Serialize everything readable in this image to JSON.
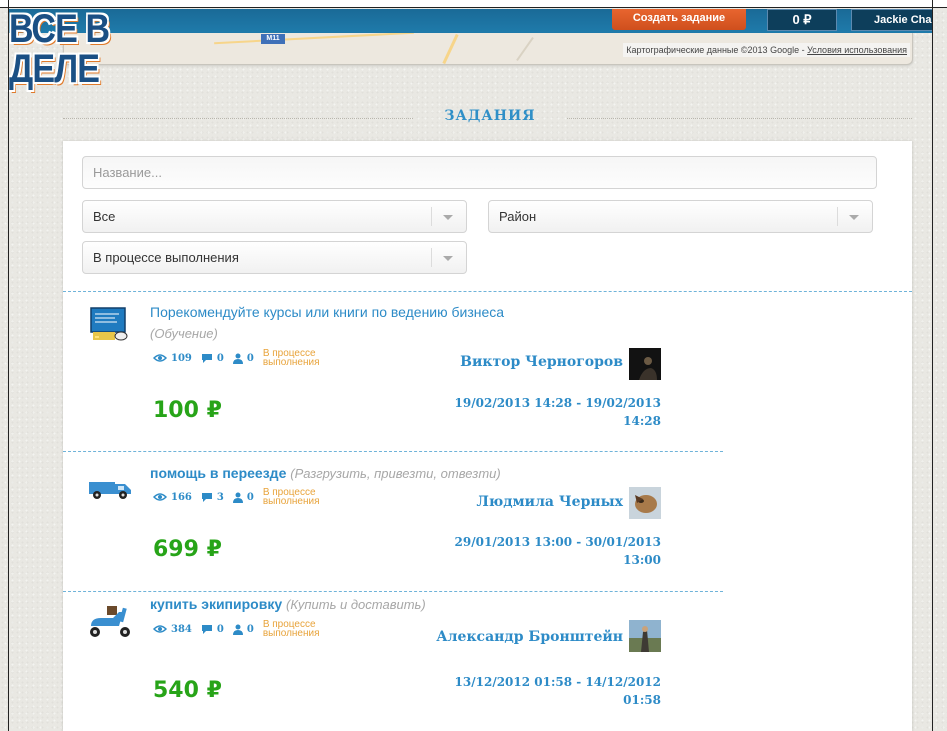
{
  "nav": {
    "logo_text": "ВСЕ В ДЕЛЕ",
    "create_task_label": "Создать задание",
    "balance_label": "0 ₽",
    "user_label": "Jackie Chan"
  },
  "map": {
    "shield_label": "M11",
    "attribution": "Картографические данные ©2013 Google - ",
    "terms_link": "Условия использования"
  },
  "section_title": "ЗАДАНИЯ",
  "filters": {
    "name_placeholder": "Название...",
    "category_value": "Все",
    "district_value": "Район",
    "status_value": "В процессе выполнения"
  },
  "colors": {
    "accent_blue": "#2d8bc7",
    "price_green": "#27a418",
    "status_orange": "#e8a33a",
    "create_orange": "#e15b27",
    "topbar_blue": "#1f7bab"
  },
  "tasks": [
    {
      "icon": "blackboard-icon",
      "title": "Порекомендуйте курсы или книги по ведению бизнеса",
      "category": "(Обучение)",
      "views": "109",
      "comments": "0",
      "responses": "0",
      "status": "В процессе выполнения",
      "author": "Виктор Черногоров",
      "avatar": "avatar-dark",
      "price": "100 ₽",
      "dates_line1": "19/02/2013 14:28 - 19/02/2013",
      "dates_line2": "14:28"
    },
    {
      "icon": "van-icon",
      "title": "помощь в переезде",
      "category": "(Разгрузить, привезти, отвезти)",
      "views": "166",
      "comments": "3",
      "responses": "0",
      "status": "В процессе выполнения",
      "author": "Людмила Черных",
      "avatar": "avatar-dog",
      "price": "699 ₽",
      "dates_line1": "29/01/2013 13:00 - 30/01/2013",
      "dates_line2": "13:00"
    },
    {
      "icon": "scooter-icon",
      "title": "купить экипировку",
      "category": "(Купить и доставить)",
      "views": "384",
      "comments": "0",
      "responses": "0",
      "status": "В процессе выполнения",
      "author": "Александр Бронштейн",
      "avatar": "avatar-landscape",
      "price": "540 ₽",
      "dates_line1": "13/12/2012 01:58 - 14/12/2012",
      "dates_line2": "01:58"
    }
  ]
}
